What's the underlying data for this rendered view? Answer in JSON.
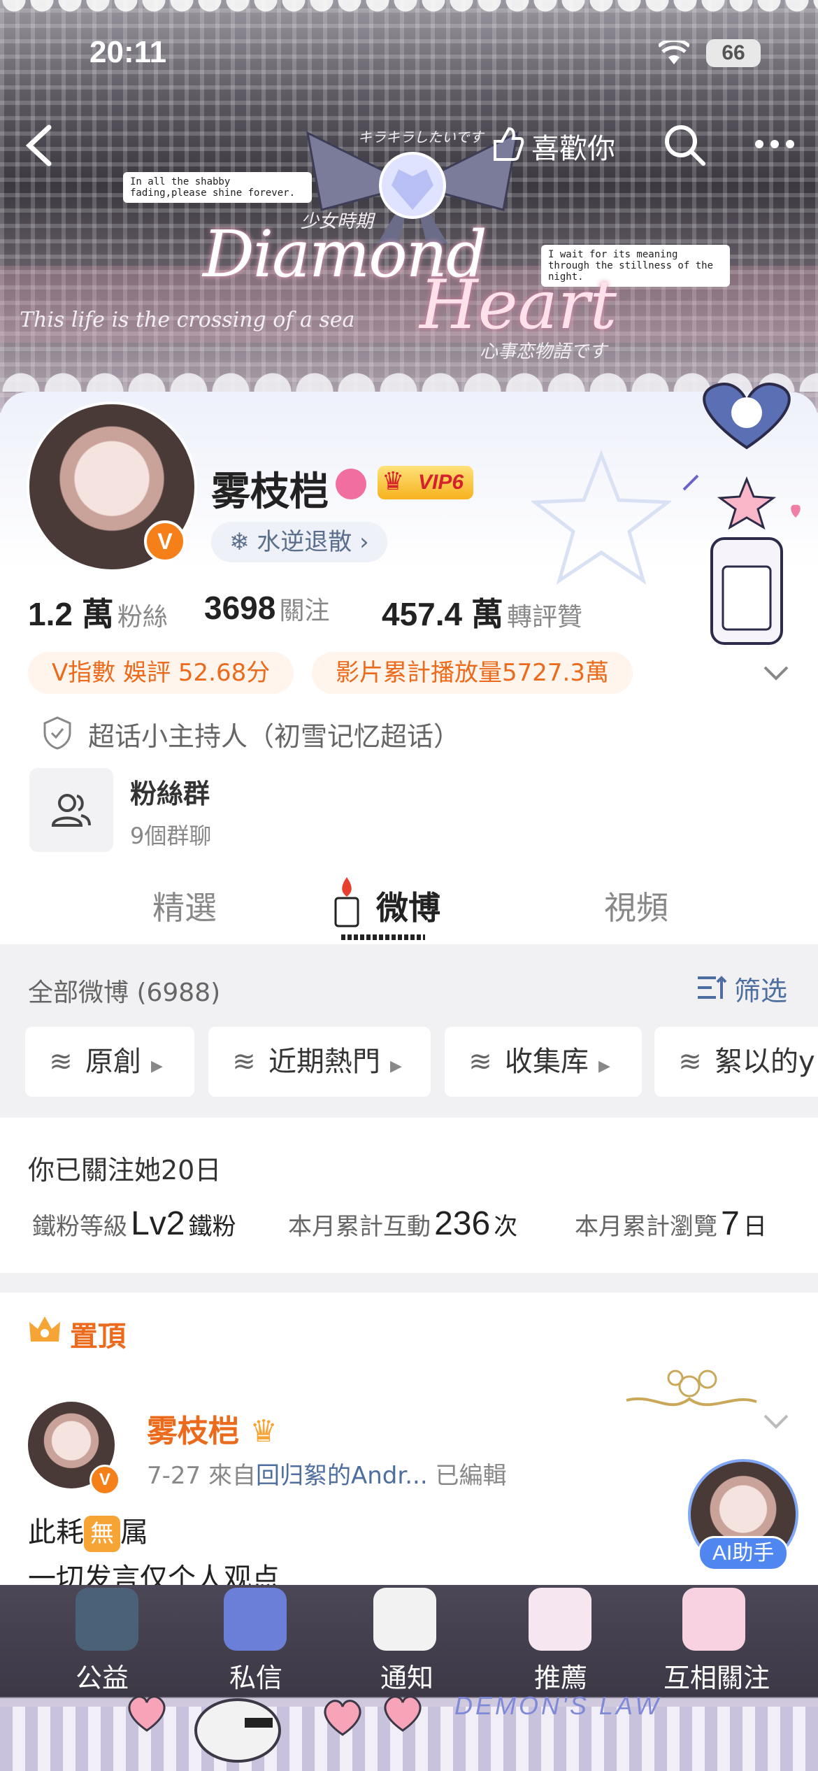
{
  "status_bar": {
    "time": "20:11",
    "battery": "66"
  },
  "nav": {
    "like_label": "喜歡你"
  },
  "banner": {
    "note_left": "In all the shabby fading,please shine forever.",
    "note_right": "I wait for its meaning through the stillness of the night.",
    "title_1": "Diamond",
    "title_2": "Heart",
    "jp_top": "キラキラしたいです",
    "jp_bottom": "心事恋物語です",
    "cn_label": "少女時期",
    "tagline": "This life is the crossing of a sea"
  },
  "profile": {
    "name": "雾枝桤",
    "vip_level": "VIP6",
    "tag": "水逆退散",
    "stats": [
      {
        "num": "1.2 萬",
        "label": "粉絲"
      },
      {
        "num": "3698",
        "label": "關注"
      },
      {
        "num": "457.4 萬",
        "label": "轉評贊"
      }
    ],
    "vindex": "V指數 娛評 52.68分",
    "video_plays": "影片累計播放量5727.3萬",
    "supertopic": "超话小主持人（初雪记忆超话）",
    "fan_group_title": "粉絲群",
    "fan_group_sub": "9個群聊"
  },
  "tabs": [
    {
      "label": "精選"
    },
    {
      "label": "微博"
    },
    {
      "label": "視頻"
    }
  ],
  "feed": {
    "all_label": "全部微博 (6988)",
    "filter_label": "筛选",
    "chips": [
      "原創",
      "近期熱門",
      "收集库",
      "絮以的y"
    ]
  },
  "follow": {
    "title": "你已關注她20日",
    "level_label": "鐵粉等級",
    "level_value": "Lv2",
    "level_suffix": "鐵粉",
    "interact_label": "本月累計互動",
    "interact_value": "236",
    "interact_unit": "次",
    "views_label": "本月累計瀏覽",
    "views_value": "7",
    "views_unit": "日"
  },
  "post": {
    "pinned_label": "置頂",
    "author": "雾枝桤",
    "date": "7-27",
    "from_prefix": "來自",
    "source": "回归絮的Andr...",
    "edited": "已編輯",
    "line1_a": "此耗",
    "line1_badge": "無",
    "line1_b": "属",
    "line2": "一切发言仅个人观点"
  },
  "ai_label": "AI助手",
  "tabbar": {
    "items": [
      "公益",
      "私信",
      "通知",
      "推薦",
      "互相關注"
    ],
    "brand": "DEMON'S LAW"
  }
}
